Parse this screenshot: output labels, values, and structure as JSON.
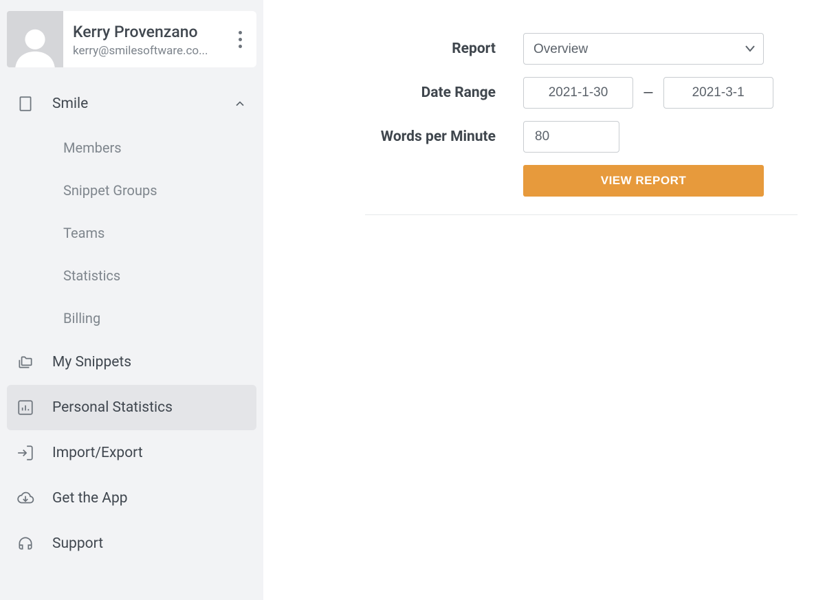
{
  "profile": {
    "name": "Kerry Provenzano",
    "email": "kerry@smilesoftware.co..."
  },
  "sidebar": {
    "org": {
      "label": "Smile"
    },
    "org_children": [
      {
        "label": "Members"
      },
      {
        "label": "Snippet Groups"
      },
      {
        "label": "Teams"
      },
      {
        "label": "Statistics"
      },
      {
        "label": "Billing"
      }
    ],
    "items": [
      {
        "label": "My Snippets"
      },
      {
        "label": "Personal Statistics"
      },
      {
        "label": "Import/Export"
      },
      {
        "label": "Get the App"
      },
      {
        "label": "Support"
      }
    ]
  },
  "form": {
    "report_label": "Report",
    "report_value": "Overview",
    "date_range_label": "Date Range",
    "date_from": "2021-1-30",
    "date_to": "2021-3-1",
    "date_sep": "—",
    "wpm_label": "Words per Minute",
    "wpm_value": "80",
    "button": "VIEW REPORT"
  },
  "colors": {
    "accent": "#e79a3c",
    "sidebar_bg": "#f2f3f5",
    "text_primary": "#40474f",
    "text_muted": "#7f868d",
    "border": "#c8ccd0"
  }
}
